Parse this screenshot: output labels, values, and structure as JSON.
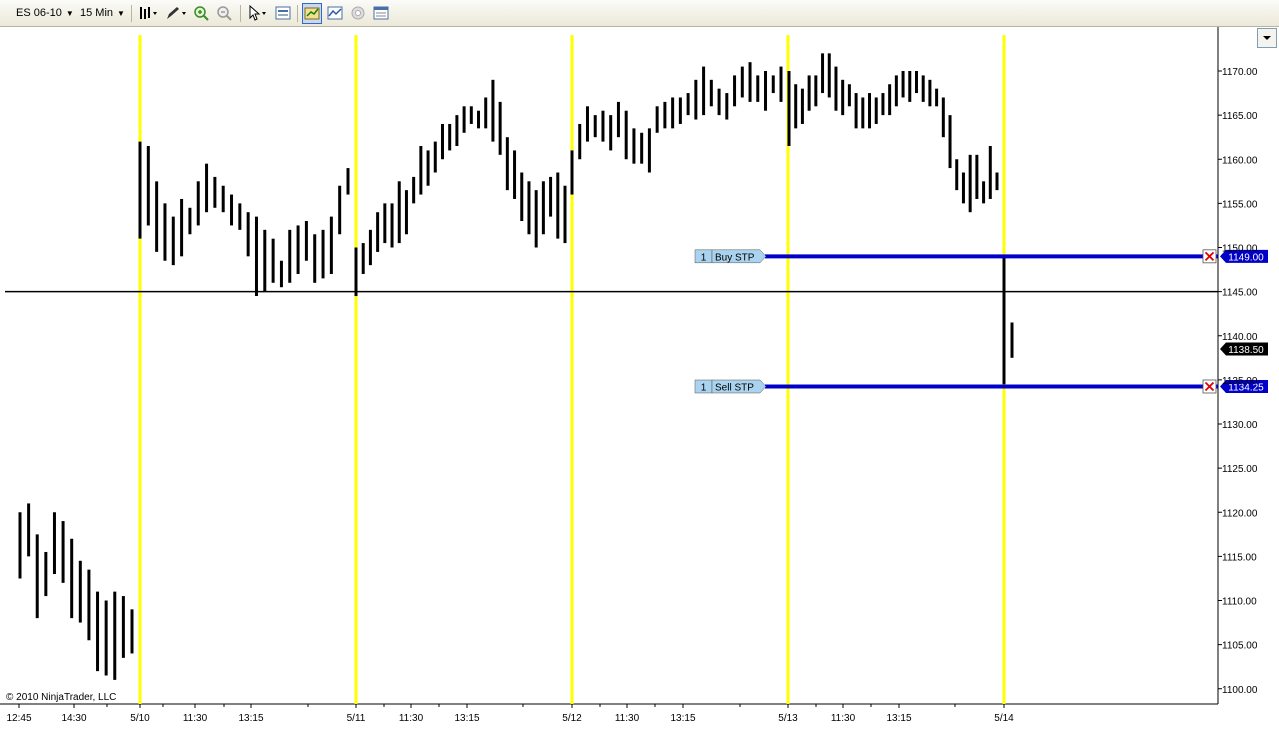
{
  "toolbar": {
    "instrument": "ES 06-10",
    "interval": "15 Min",
    "icons": [
      "bar-type-icon",
      "drawing-pencil-icon",
      "zoom-in-icon",
      "zoom-out-icon",
      "cursor-icon",
      "data-box-icon",
      "chart-trader-icon",
      "indicators-icon",
      "strategy-icon",
      "properties-icon"
    ]
  },
  "chart_data": {
    "type": "ohlc-bar",
    "instrument": "ES 06-10",
    "interval": "15 Min",
    "ylim": [
      1098.5,
      1173.5
    ],
    "y_ticks": [
      1100,
      1105,
      1110,
      1115,
      1120,
      1125,
      1130,
      1135,
      1140,
      1145,
      1150,
      1155,
      1160,
      1165,
      1170
    ],
    "y_tick_labels": [
      "1100.00",
      "1105.00",
      "1110.00",
      "1115.00",
      "1120.00",
      "1125.00",
      "1130.00",
      "1135.00",
      "1140.00",
      "1145.00",
      "1150.00",
      "1155.00",
      "1160.00",
      "1165.00",
      "1170.00"
    ],
    "x_tick_labels": [
      "12:45",
      "14:30",
      "5/10",
      "11:30",
      "13:15",
      "5/11",
      "11:30",
      "13:15",
      "5/12",
      "11:30",
      "13:15",
      "5/13",
      "11:30",
      "13:15",
      "5/14"
    ],
    "session_dates": [
      "5/10",
      "5/11",
      "5/12",
      "5/13",
      "5/14"
    ],
    "bars": [
      [
        1120.0,
        1112.5
      ],
      [
        1121.0,
        1115.0
      ],
      [
        1117.5,
        1108.0
      ],
      [
        1115.5,
        1110.5
      ],
      [
        1120.0,
        1113.0
      ],
      [
        1119.0,
        1112.0
      ],
      [
        1117.0,
        1108.0
      ],
      [
        1114.5,
        1107.5
      ],
      [
        1113.5,
        1105.5
      ],
      [
        1111.0,
        1102.0
      ],
      [
        1110.0,
        1101.5
      ],
      [
        1111.0,
        1101.0
      ],
      [
        1110.5,
        1103.5
      ],
      [
        1109.0,
        1104.0
      ],
      [
        1162.0,
        1151.0
      ],
      [
        1161.5,
        1152.5
      ],
      [
        1157.5,
        1149.5
      ],
      [
        1155.0,
        1148.5
      ],
      [
        1153.5,
        1148.0
      ],
      [
        1155.5,
        1149.0
      ],
      [
        1154.5,
        1151.5
      ],
      [
        1157.5,
        1152.5
      ],
      [
        1159.5,
        1154.0
      ],
      [
        1158.0,
        1154.5
      ],
      [
        1157.0,
        1154.0
      ],
      [
        1156.0,
        1152.5
      ],
      [
        1155.0,
        1152.0
      ],
      [
        1154.0,
        1149.0
      ],
      [
        1153.5,
        1144.5
      ],
      [
        1152.0,
        1145.0
      ],
      [
        1151.0,
        1146.0
      ],
      [
        1148.5,
        1145.5
      ],
      [
        1152.0,
        1146.0
      ],
      [
        1152.5,
        1147.0
      ],
      [
        1153.0,
        1148.5
      ],
      [
        1151.5,
        1146.0
      ],
      [
        1152.0,
        1146.5
      ],
      [
        1153.5,
        1147.0
      ],
      [
        1157.0,
        1151.5
      ],
      [
        1159.0,
        1156.0
      ],
      [
        1150.0,
        1144.5
      ],
      [
        1150.5,
        1147.0
      ],
      [
        1152.0,
        1148.0
      ],
      [
        1154.0,
        1149.5
      ],
      [
        1155.0,
        1150.5
      ],
      [
        1155.0,
        1150.0
      ],
      [
        1157.5,
        1150.5
      ],
      [
        1156.5,
        1151.5
      ],
      [
        1158.0,
        1155.0
      ],
      [
        1161.5,
        1156.0
      ],
      [
        1161.0,
        1157.0
      ],
      [
        1162.0,
        1158.5
      ],
      [
        1164.0,
        1160.0
      ],
      [
        1164.0,
        1161.0
      ],
      [
        1165.0,
        1161.5
      ],
      [
        1166.0,
        1163.0
      ],
      [
        1166.0,
        1164.0
      ],
      [
        1165.5,
        1163.5
      ],
      [
        1167.0,
        1163.5
      ],
      [
        1169.0,
        1162.0
      ],
      [
        1166.5,
        1160.5
      ],
      [
        1162.5,
        1156.5
      ],
      [
        1161.0,
        1155.5
      ],
      [
        1158.5,
        1153.0
      ],
      [
        1157.5,
        1151.5
      ],
      [
        1156.5,
        1150.0
      ],
      [
        1157.5,
        1151.5
      ],
      [
        1158.0,
        1153.5
      ],
      [
        1158.5,
        1151.0
      ],
      [
        1157.0,
        1150.5
      ],
      [
        1161.0,
        1156.0
      ],
      [
        1164.0,
        1160.0
      ],
      [
        1166.0,
        1162.0
      ],
      [
        1165.0,
        1162.5
      ],
      [
        1165.5,
        1162.0
      ],
      [
        1165.0,
        1161.0
      ],
      [
        1166.5,
        1162.5
      ],
      [
        1165.5,
        1160.0
      ],
      [
        1163.5,
        1159.5
      ],
      [
        1163.0,
        1159.5
      ],
      [
        1163.5,
        1158.5
      ],
      [
        1166.0,
        1163.0
      ],
      [
        1166.5,
        1163.5
      ],
      [
        1167.0,
        1163.5
      ],
      [
        1167.0,
        1164.0
      ],
      [
        1167.5,
        1165.0
      ],
      [
        1169.0,
        1164.5
      ],
      [
        1170.5,
        1165.0
      ],
      [
        1169.0,
        1166.0
      ],
      [
        1168.0,
        1165.0
      ],
      [
        1167.5,
        1164.5
      ],
      [
        1169.5,
        1166.0
      ],
      [
        1170.5,
        1167.0
      ],
      [
        1171.0,
        1166.5
      ],
      [
        1169.5,
        1166.5
      ],
      [
        1170.0,
        1165.5
      ],
      [
        1169.5,
        1167.5
      ],
      [
        1170.5,
        1166.5
      ],
      [
        1170.0,
        1161.5
      ],
      [
        1168.5,
        1163.5
      ],
      [
        1168.0,
        1164.0
      ],
      [
        1169.5,
        1165.5
      ],
      [
        1169.5,
        1166.0
      ],
      [
        1172.0,
        1167.5
      ],
      [
        1172.0,
        1167.0
      ],
      [
        1170.5,
        1165.5
      ],
      [
        1169.0,
        1165.0
      ],
      [
        1168.5,
        1166.0
      ],
      [
        1167.5,
        1163.5
      ],
      [
        1167.0,
        1163.5
      ],
      [
        1167.5,
        1163.5
      ],
      [
        1167.0,
        1164.0
      ],
      [
        1167.5,
        1165.0
      ],
      [
        1168.5,
        1165.0
      ],
      [
        1169.5,
        1166.0
      ],
      [
        1170.0,
        1167.0
      ],
      [
        1170.0,
        1166.5
      ],
      [
        1170.0,
        1167.5
      ],
      [
        1169.5,
        1166.5
      ],
      [
        1169.0,
        1166.0
      ],
      [
        1168.0,
        1166.0
      ],
      [
        1167.0,
        1162.5
      ],
      [
        1165.0,
        1159.0
      ],
      [
        1160.0,
        1156.5
      ],
      [
        1158.5,
        1155.0
      ],
      [
        1160.5,
        1154.0
      ],
      [
        1160.5,
        1155.5
      ],
      [
        1157.5,
        1155.0
      ],
      [
        1161.5,
        1155.5
      ],
      [
        1158.5,
        1156.5
      ],
      [
        1149.0,
        1134.5
      ],
      [
        1141.5,
        1137.5
      ]
    ],
    "horizontal_line": 1145.0,
    "last_price": "1138.50",
    "orders": [
      {
        "qty": "1",
        "type": "Buy STP",
        "price": "1149.00",
        "price_value": 1149.0
      },
      {
        "qty": "1",
        "type": "Sell STP",
        "price": "1134.25",
        "price_value": 1134.25
      }
    ]
  },
  "copyright": "© 2010 NinjaTrader, LLC",
  "colors": {
    "session_line": "#ffff00",
    "order_line": "#0000c8",
    "order_label_bg": "#a9d3ef",
    "last_price_bg": "#000000",
    "bar": "#000000",
    "cancel_icon": "#e00000"
  }
}
